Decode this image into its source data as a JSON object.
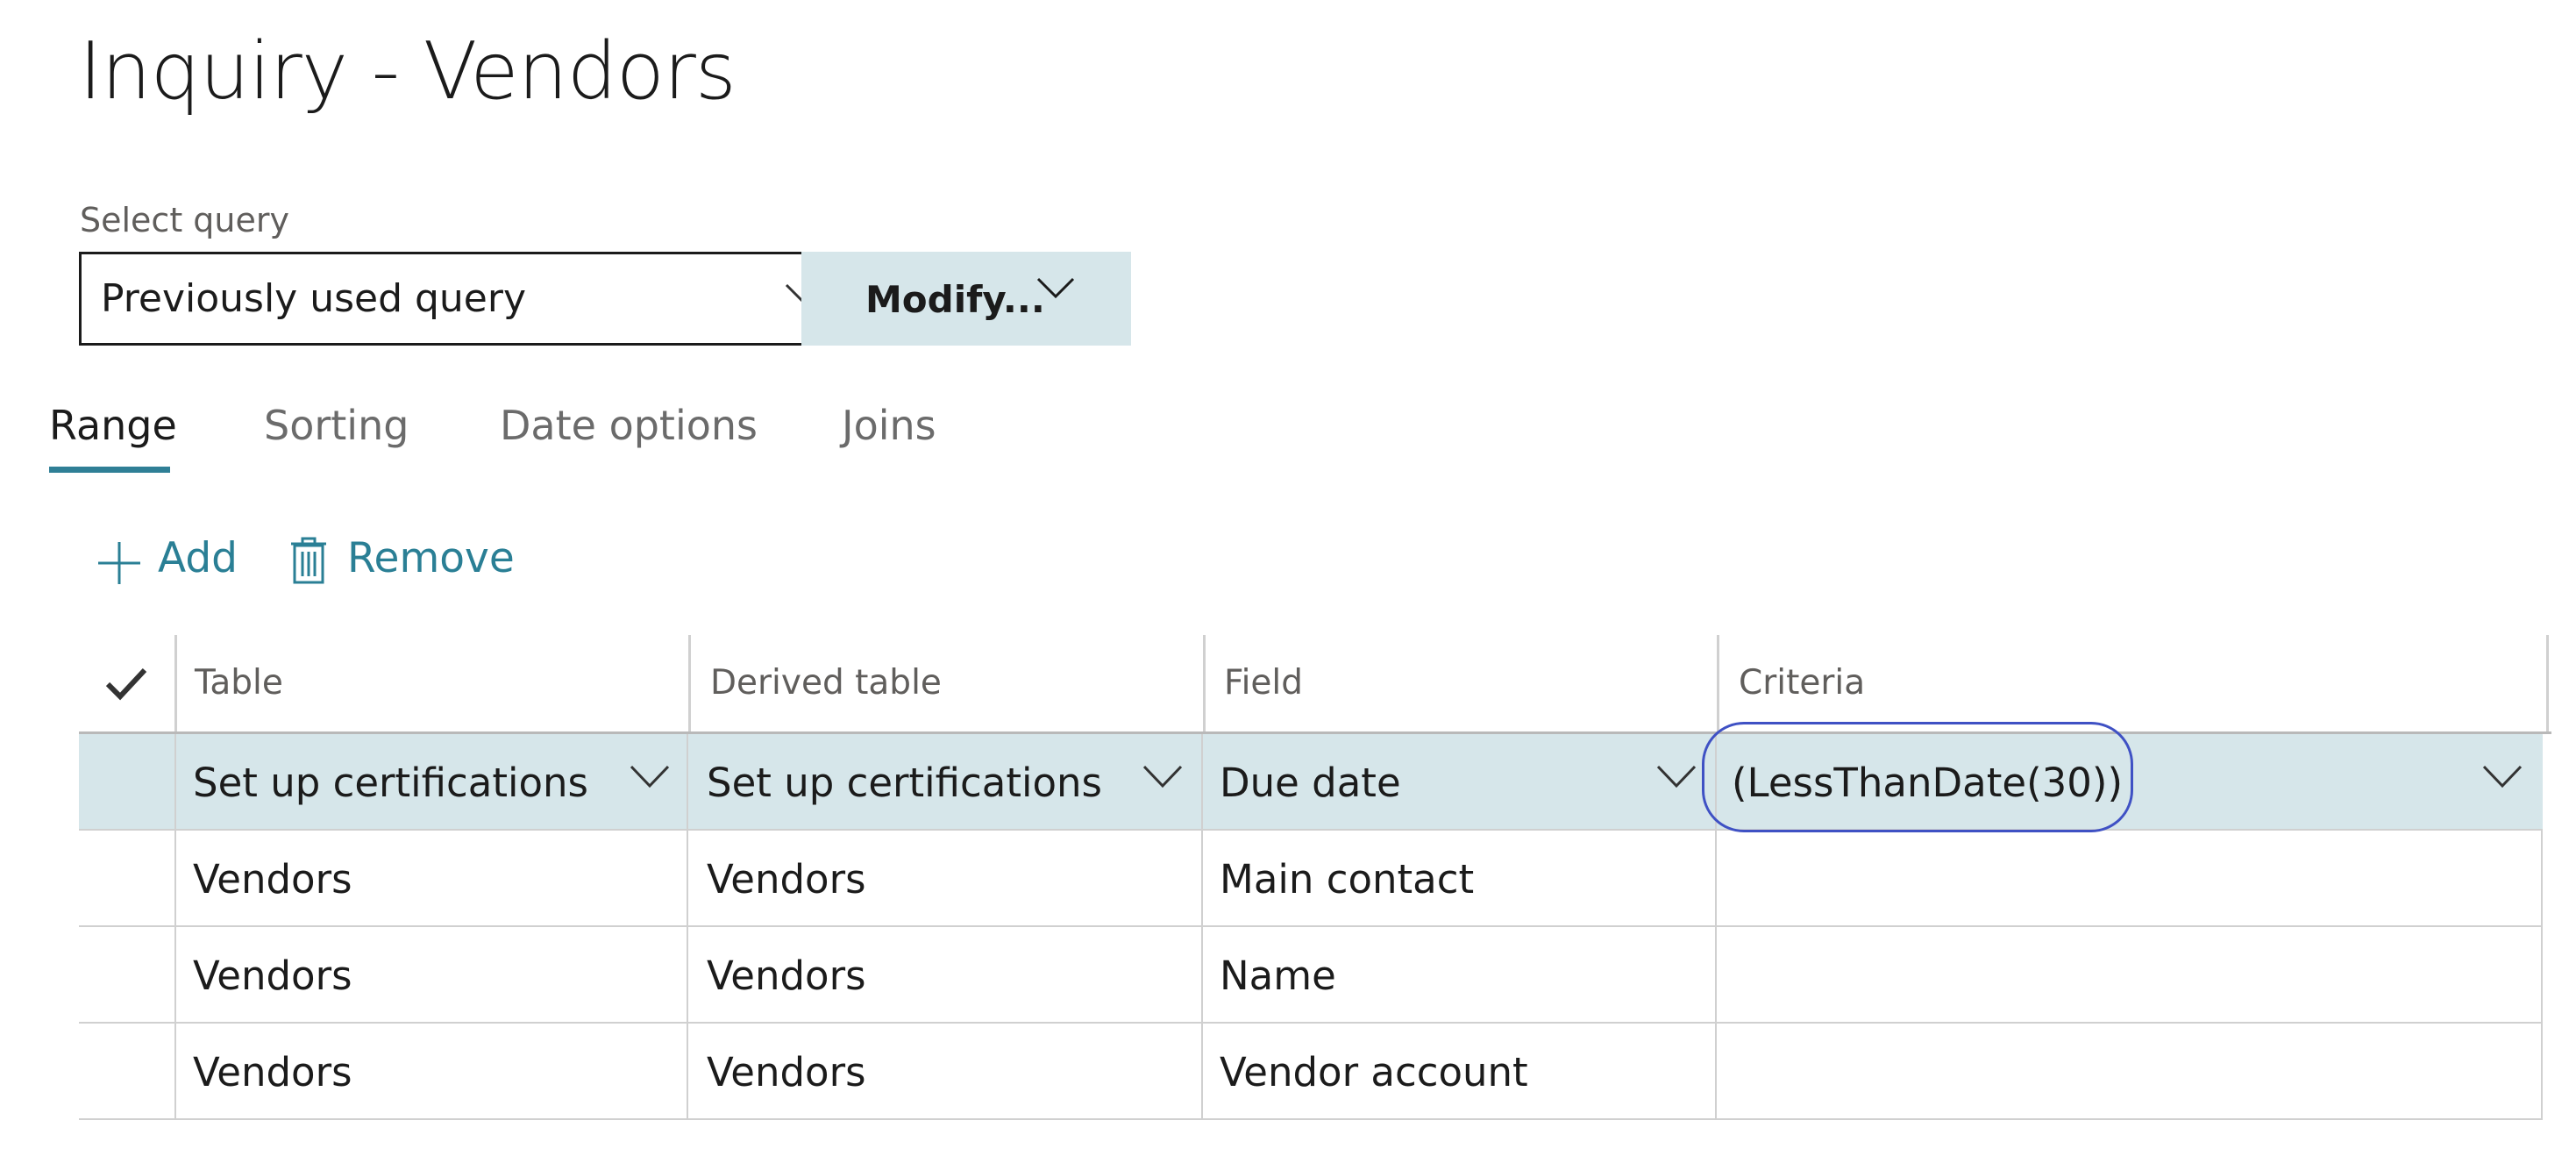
{
  "page": {
    "title": "Inquiry - Vendors"
  },
  "query": {
    "label": "Select query",
    "selected": "Previously used query",
    "modify_label": "Modify..."
  },
  "tabs": [
    {
      "label": "Range",
      "active": true
    },
    {
      "label": "Sorting",
      "active": false
    },
    {
      "label": "Date options",
      "active": false
    },
    {
      "label": "Joins",
      "active": false
    }
  ],
  "actions": {
    "add_label": "Add",
    "remove_label": "Remove"
  },
  "grid": {
    "columns": [
      "Table",
      "Derived table",
      "Field",
      "Criteria"
    ],
    "rows": [
      {
        "table": "Set up certifications",
        "derived": "Set up certifications",
        "field": "Due date",
        "criteria": "(LessThanDate(30))",
        "selected": true
      },
      {
        "table": "Vendors",
        "derived": "Vendors",
        "field": "Main contact",
        "criteria": "",
        "selected": false
      },
      {
        "table": "Vendors",
        "derived": "Vendors",
        "field": "Name",
        "criteria": "",
        "selected": false
      },
      {
        "table": "Vendors",
        "derived": "Vendors",
        "field": "Vendor account",
        "criteria": "",
        "selected": false
      }
    ]
  },
  "colors": {
    "accent": "#2a7f95",
    "selected_row": "#d6e6ea",
    "highlight_ring": "#3f51c4"
  },
  "icons": [
    "chevron-down-icon",
    "plus-icon",
    "trash-icon",
    "checkmark-icon"
  ]
}
